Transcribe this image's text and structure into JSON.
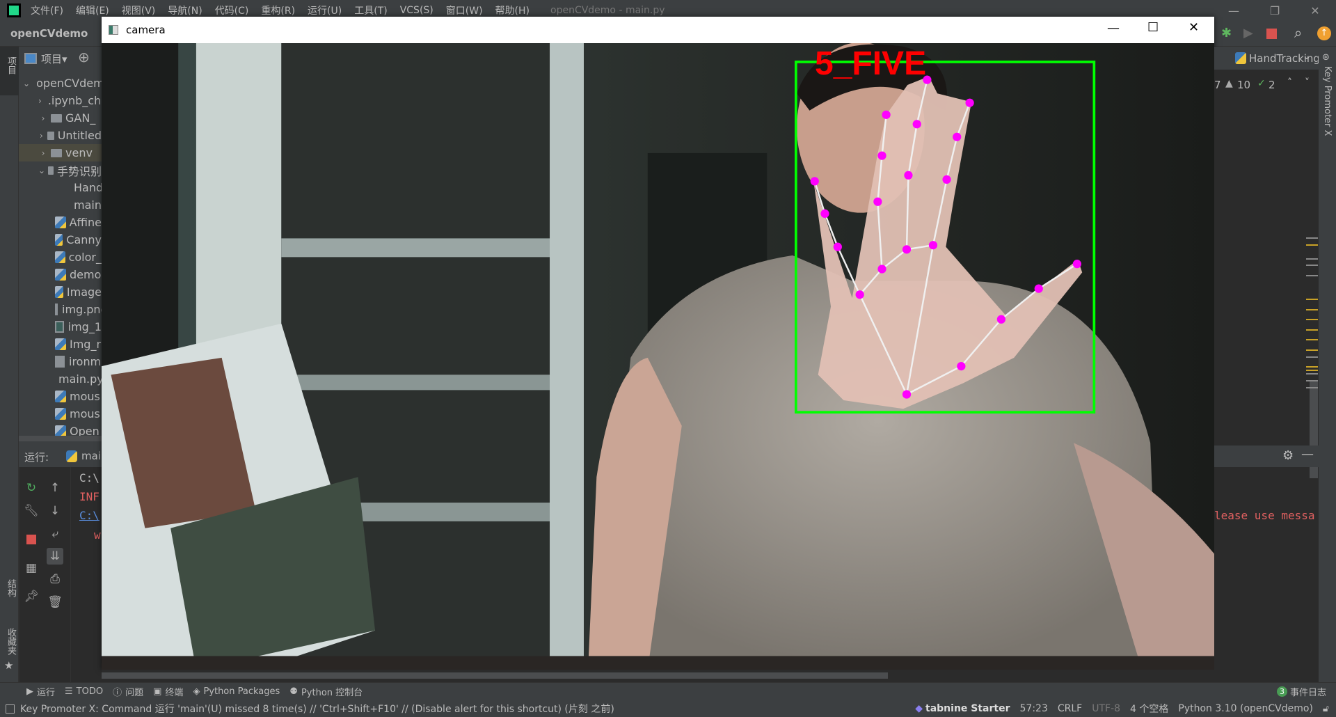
{
  "menu": {
    "items": [
      "文件(F)",
      "编辑(E)",
      "视图(V)",
      "导航(N)",
      "代码(C)",
      "重构(R)",
      "运行(U)",
      "工具(T)",
      "VCS(S)",
      "窗口(W)",
      "帮助(H)"
    ],
    "title": "openCVdemo - main.py"
  },
  "nav": {
    "project": "openCVdemo"
  },
  "left_strip": {
    "project_tab": "项目",
    "structure_tab": "结构",
    "favorites_tab": "收藏夹"
  },
  "project_panel": {
    "header": "项目▾",
    "tree": [
      {
        "label": "openCVdemo",
        "type": "folder",
        "open": true,
        "depth": 0
      },
      {
        "label": ".ipynb_checkpoints",
        "type": "folder",
        "open": false,
        "depth": 1
      },
      {
        "label": "GAN_",
        "type": "folder",
        "open": false,
        "depth": 1
      },
      {
        "label": "Untitled",
        "type": "folder",
        "open": false,
        "depth": 1
      },
      {
        "label": "venv",
        "type": "folder",
        "open": false,
        "depth": 1,
        "selected": true
      },
      {
        "label": "手势识别",
        "type": "folder",
        "open": true,
        "depth": 1
      },
      {
        "label": "HandTrackingModule.py",
        "type": "py",
        "depth": 2
      },
      {
        "label": "main.py",
        "type": "py",
        "depth": 2
      },
      {
        "label": "Affine",
        "type": "py",
        "depth": 1
      },
      {
        "label": "Canny",
        "type": "py",
        "depth": 1
      },
      {
        "label": "color_",
        "type": "py",
        "depth": 1
      },
      {
        "label": "demo",
        "type": "py",
        "depth": 1
      },
      {
        "label": "Image",
        "type": "py",
        "depth": 1
      },
      {
        "label": "img.png",
        "type": "img",
        "depth": 1
      },
      {
        "label": "img_1",
        "type": "img",
        "depth": 1
      },
      {
        "label": "Img_r",
        "type": "py",
        "depth": 1
      },
      {
        "label": "ironm",
        "type": "txt",
        "depth": 1
      },
      {
        "label": "main.py",
        "type": "py",
        "depth": 1
      },
      {
        "label": "mous",
        "type": "py",
        "depth": 1
      },
      {
        "label": "mous",
        "type": "py",
        "depth": 1
      },
      {
        "label": "Open",
        "type": "py",
        "depth": 1
      }
    ]
  },
  "run_panel": {
    "label": "运行:",
    "tab": "main",
    "console": [
      "C:\\",
      "INF",
      "C:\\",
      "w"
    ]
  },
  "camera": {
    "title": "camera",
    "gesture_label": "5_FIVE",
    "box_color": "#00ff00",
    "landmark_color": "#ff00ff",
    "label_color": "#ff0000"
  },
  "editor": {
    "tab": "HandTracking",
    "inspections": {
      "errors": "7",
      "warnings": "10",
      "weak": "2"
    },
    "console_text": "lease use messa"
  },
  "right_strip": {
    "label": "Key Promoter X"
  },
  "tool_windows": {
    "run": "运行",
    "todo": "TODO",
    "problems": "问题",
    "terminal": "终端",
    "packages": "Python Packages",
    "console": "Python 控制台",
    "event_count": "3",
    "event_log": "事件日志"
  },
  "status": {
    "message": "Key Promoter X: Command 运行 'main'(U) missed 8 time(s) // 'Ctrl+Shift+F10' // (Disable alert for this shortcut) (片刻 之前)",
    "tabnine": "tabnine Starter",
    "position": "57:23",
    "line_sep": "CRLF",
    "encoding": "UTF-8",
    "indent": "4 个空格",
    "interpreter": "Python 3.10 (openCVdemo)"
  }
}
